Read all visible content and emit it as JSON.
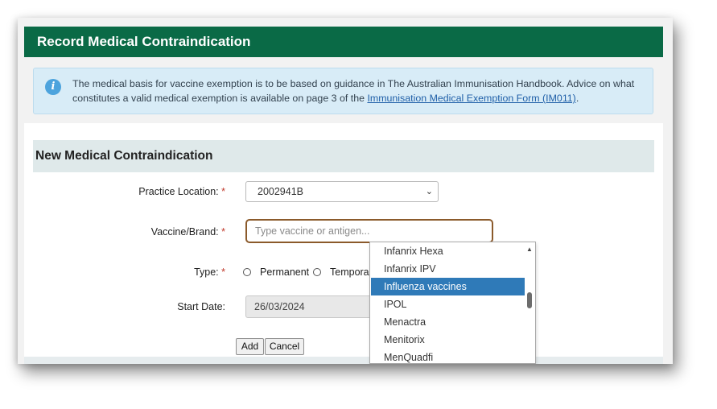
{
  "title": "Record Medical Contraindication",
  "info": {
    "text": "The medical basis for vaccine exemption is to be based on guidance in The Australian Immunisation Handbook. Advice on what constitutes a valid medical exemption is available on page 3 of the ",
    "link": "Immunisation Medical Exemption Form (IM011)",
    "suffix": "."
  },
  "section_title": "New Medical Contraindication",
  "form": {
    "practice_location_label": "Practice Location:",
    "practice_location_value": "2002941B",
    "vaccine_label": "Vaccine/Brand:",
    "vaccine_placeholder": "Type vaccine or antigen...",
    "type_label": "Type:",
    "type_options": [
      "Permanent",
      "Temporary"
    ],
    "start_date_label": "Start Date:",
    "start_date_value": "26/03/2024",
    "required_mark": "*"
  },
  "buttons": {
    "add": "Add",
    "cancel": "Cancel"
  },
  "dropdown": {
    "items": [
      "Infanrix Hexa",
      "Infanrix IPV",
      "Influenza vaccines",
      "IPOL",
      "Menactra",
      "Menitorix",
      "MenQuadfi"
    ],
    "selected": "Influenza vaccines"
  },
  "colors": {
    "header_bg": "#0a6a46",
    "selected_item": "#2f7ab8",
    "input_focus_border": "#8b5a2b"
  }
}
